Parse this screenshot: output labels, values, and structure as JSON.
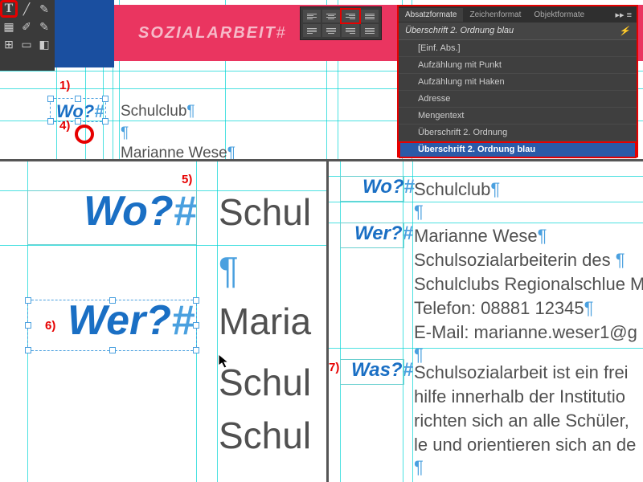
{
  "toolbar": {
    "tools": [
      "T",
      "✦",
      "✎",
      "⊞",
      "□",
      "▥"
    ]
  },
  "header": {
    "title": "SOZIALARBEIT"
  },
  "panel": {
    "tabs": [
      "Absatzformate",
      "Zeichenformat",
      "Objektformate"
    ],
    "current": "Überschrift 2. Ordnung blau",
    "items": [
      "[Einf. Abs.]",
      "Aufzählung mit Punkt",
      "Aufzählung mit Haken",
      "Adresse",
      "Mengentext",
      "Überschrift 2. Ordnung",
      "Überschrift 2. Ordnung blau"
    ],
    "selected_index": 6
  },
  "annotations": {
    "a1": "1)",
    "a4": "4)",
    "a5": "5)",
    "a6": "6)",
    "a7": "7)"
  },
  "doc": {
    "wo": "Wo?",
    "wer": "Wer?",
    "was": "Was?",
    "schulclub": "Schulclub",
    "pilcrow": "¶",
    "marianne": "Marianne Wese",
    "line3": "Schulsozialarbeiterin des",
    "line4": "Schulclubs Regionalschlue M",
    "line5": "Telefon: 08881 12345",
    "line6": "E-Mail: marianne.weser1@g",
    "was1": "Schulsozialarbeit ist ein frei",
    "was2": "hilfe innerhalb der Institutio",
    "was3": "richten sich an alle Schüler,",
    "was4": "le und orientieren sich an de",
    "zoom_schul": "Schul",
    "zoom_maria": "Maria",
    "zoom_schul2": "Schul",
    "zoom_schul3": "Schul"
  }
}
